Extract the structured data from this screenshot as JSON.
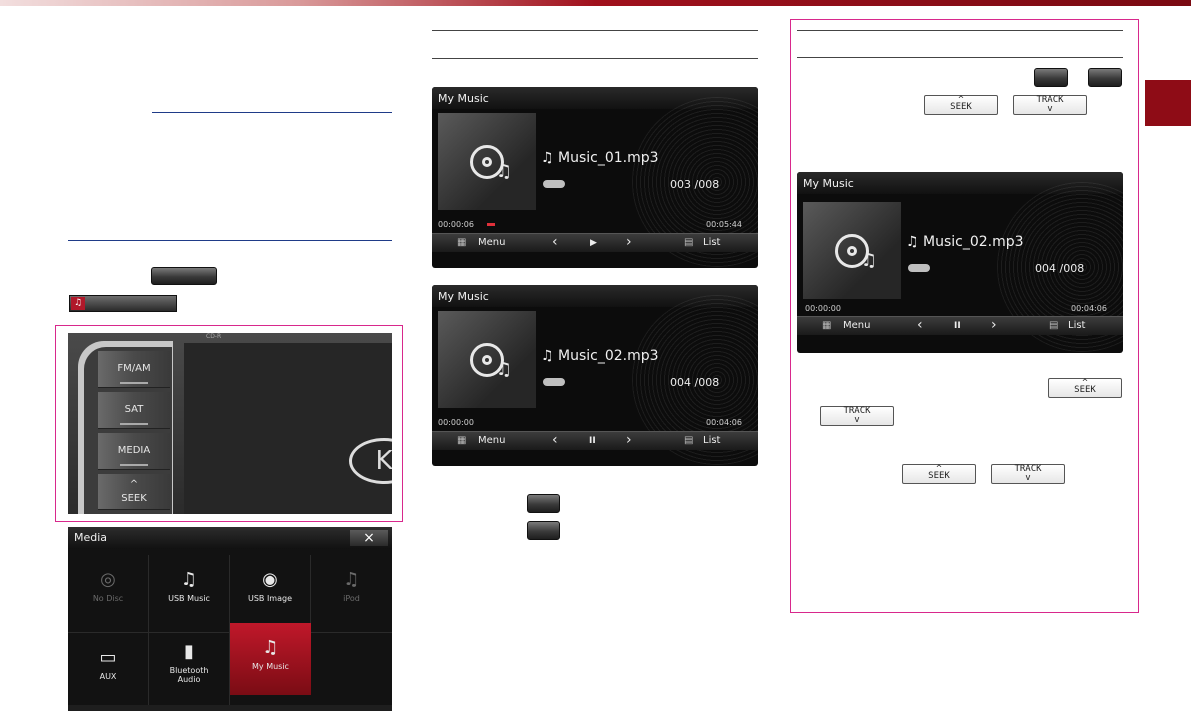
{
  "colors": {
    "accent": "#8e0c16",
    "highlight_box": "#d8288c",
    "selected_cell": "#a4101c"
  },
  "screens": [
    {
      "title": "My Music",
      "song": "♫ Music_01.mp3",
      "track": "003 /008",
      "elapsed": "00:00:06",
      "total": "00:05:44",
      "bar": {
        "menu": "Menu",
        "prev": "‹",
        "play": "▶",
        "next": "›",
        "list": "List"
      }
    },
    {
      "title": "My Music",
      "song": "♫ Music_02.mp3",
      "track": "004 /008",
      "elapsed": "00:00:00",
      "total": "00:04:06",
      "bar": {
        "menu": "Menu",
        "prev": "‹",
        "play": "II",
        "next": "›",
        "list": "List"
      }
    },
    {
      "title": "My Music",
      "song": "♫ Music_02.mp3",
      "track": "004 /008",
      "elapsed": "00:00:00",
      "total": "00:04:06",
      "bar": {
        "menu": "Menu",
        "prev": "‹",
        "play": "II",
        "next": "›",
        "list": "List"
      }
    }
  ],
  "keys": {
    "seek_caret": "^",
    "seek": "SEEK",
    "track": "TRACK",
    "track_caret": "v"
  },
  "head_unit": {
    "buttons": [
      "FM/AM",
      "SAT",
      "MEDIA",
      "SEEK"
    ],
    "seek_caret": "^",
    "top_label": "CD-R"
  },
  "media_menu": {
    "title": "Media",
    "close": "×",
    "items": [
      {
        "label": "No Disc",
        "icon": "◎"
      },
      {
        "label": "USB Music",
        "icon": "♫"
      },
      {
        "label": "USB Image",
        "icon": "◉"
      },
      {
        "label": "iPod",
        "icon": "♫"
      },
      {
        "label": "AUX",
        "icon": "▭"
      },
      {
        "label": "Bluetooth Audio",
        "icon": "▮"
      },
      {
        "label": "My Music",
        "icon": "♫"
      },
      {
        "label": "",
        "icon": ""
      }
    ]
  }
}
